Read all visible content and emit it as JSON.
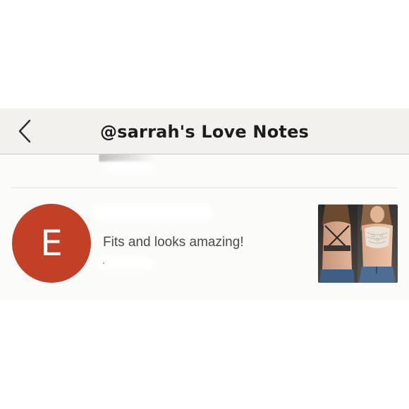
{
  "header": {
    "title": "@sarrah's Love Notes",
    "back_icon": "chevron-left-icon"
  },
  "note": {
    "avatar_letter": "E",
    "avatar_color": "#c24126",
    "text": "Fits and looks amazing!"
  },
  "colors": {
    "header_bg": "#f2f1ee",
    "content_bg": "#fbfbfa",
    "title_text": "#1d1d1d",
    "note_text": "#4a4a4a"
  }
}
